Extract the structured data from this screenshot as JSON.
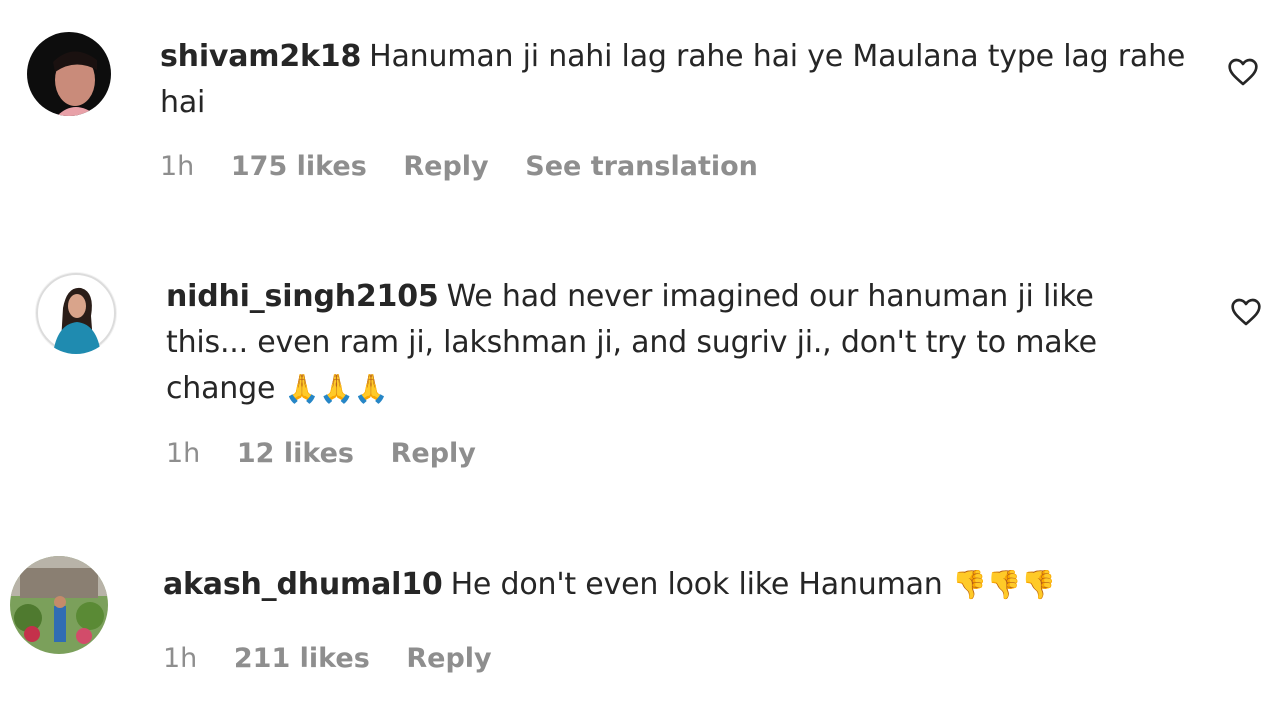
{
  "comments": [
    {
      "username": "shivam2k18",
      "text": "Hanuman ji nahi lag rahe hai ye Maulana type lag rahe hai",
      "emoji": "",
      "time": "1h",
      "likes": "175 likes",
      "reply": "Reply",
      "translation": "See translation"
    },
    {
      "username": "nidhi_singh2105",
      "text": "We had never imagined our hanuman ji like this... even ram ji, lakshman ji, and sugriv ji., don't try to make change",
      "emoji": "🙏🙏🙏",
      "time": "1h",
      "likes": "12 likes",
      "reply": "Reply"
    },
    {
      "username": "akash_dhumal10",
      "text": "He don't even look like Hanuman",
      "emoji": "👎👎👎",
      "time": "1h",
      "likes": "211 likes",
      "reply": "Reply"
    }
  ]
}
